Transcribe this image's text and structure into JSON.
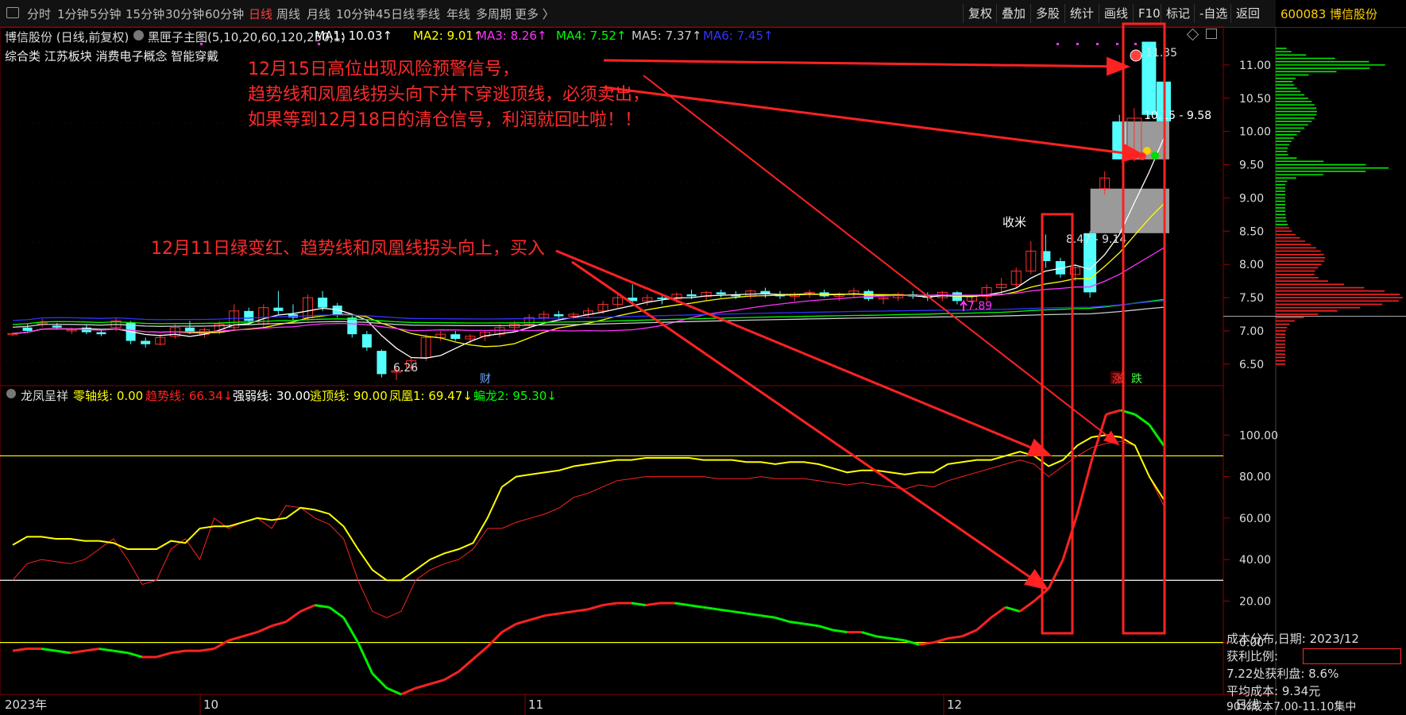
{
  "toolbar": {
    "periods": [
      "分时",
      "1分钟",
      "5分钟",
      "15分钟",
      "30分钟",
      "60分钟",
      "日线",
      "周线",
      "月线",
      "10分钟",
      "45日线",
      "季线",
      "年线",
      "多周期",
      "更多 〉"
    ],
    "active_period": "日线",
    "right_buttons": [
      "复权",
      "叠加",
      "多股",
      "统计",
      "画线",
      "F10",
      "标记",
      "-自选",
      "返回"
    ]
  },
  "stock": {
    "code_name": "600083 博信股份"
  },
  "main_panel": {
    "title": "博信股份 (日线,前复权)",
    "indicator_name": "黑匣子主图(5,10,20,60,120,250,1)",
    "ma_labels": [
      {
        "text": "MA1: 10.03",
        "color": "#ffffff"
      },
      {
        "text": "MA2: 9.01",
        "color": "#ffff00"
      },
      {
        "text": "MA3: 8.26",
        "color": "#ff33ff"
      },
      {
        "text": "MA4: 7.52",
        "color": "#00ff00"
      },
      {
        "text": "MA5: 7.37",
        "color": "#cccccc"
      },
      {
        "text": "MA6: 7.45",
        "color": "#3333ff"
      }
    ],
    "tags": "综合类  江苏板块  消费电子概念  智能穿戴"
  },
  "annotations": {
    "sell_note": [
      "12月15日高位出现风险预警信号，",
      "趋势线和凤凰线拐头向下并下穿逃顶线，必须卖出，",
      "如果等到12月18日的清仓信号，利润就回吐啦！！"
    ],
    "buy_note": "12月11日绿变红、趋势线和凤凰线拐头向上，买入",
    "label_shoumi": "收米",
    "label_high": "11.35",
    "label_range1": "10.15 - 9.58",
    "label_range2": "8.47 - 9.14",
    "label_low": "6.26",
    "label_789": "7.89",
    "label_cai": "财",
    "label_zhang": "涨",
    "label_die": "跌",
    "date_2023": "2023年",
    "date_10": "10",
    "date_11": "11",
    "date_12": "12",
    "bottom_right": "日线"
  },
  "sub_panel": {
    "name": "龙凤呈祥",
    "labels": [
      {
        "text": "零轴线: 0.00",
        "color": "#ffff00"
      },
      {
        "text": "趋势线: 66.34↓",
        "color": "#ff2222"
      },
      {
        "text": "强弱线: 30.00",
        "color": "#ffffff"
      },
      {
        "text": "逃顶线: 90.00",
        "color": "#ffff00"
      },
      {
        "text": "凤凰1: 69.47↓",
        "color": "#ffff00"
      },
      {
        "text": "蝙龙2: 95.30↓",
        "color": "#00ff00"
      }
    ]
  },
  "right_info": {
    "cost_title": "成本分布,日期: 2023/12",
    "profit_ratio_label": "获利比例:",
    "profit_line": "7.22处获利盘: 8.6%",
    "avg_cost": "平均成本: 9.34元",
    "cost_90": "90%成本7.00-11.10集中"
  },
  "chart_data": [
    {
      "type": "candlestick",
      "title": "博信股份 (日线,前复权)",
      "ylim": [
        6.2,
        11.5
      ],
      "yticks": [
        6.5,
        7.0,
        7.5,
        8.0,
        8.5,
        9.0,
        9.5,
        10.0,
        10.5,
        11.0
      ],
      "ohlc": [
        [
          6.95,
          6.98,
          6.92,
          6.96
        ],
        [
          7.05,
          7.1,
          6.98,
          7.0
        ],
        [
          7.1,
          7.18,
          7.05,
          7.12
        ],
        [
          7.08,
          7.12,
          7.02,
          7.05
        ],
        [
          7.0,
          7.05,
          6.95,
          7.02
        ],
        [
          7.05,
          7.1,
          6.95,
          6.98
        ],
        [
          6.98,
          7.02,
          6.92,
          6.95
        ],
        [
          7.05,
          7.2,
          7.0,
          7.15
        ],
        [
          7.12,
          7.15,
          6.8,
          6.85
        ],
        [
          6.85,
          6.9,
          6.75,
          6.8
        ],
        [
          6.8,
          6.95,
          6.78,
          6.9
        ],
        [
          6.92,
          7.1,
          6.88,
          7.05
        ],
        [
          7.05,
          7.15,
          6.95,
          6.98
        ],
        [
          6.95,
          7.05,
          6.9,
          7.02
        ],
        [
          6.98,
          7.15,
          6.95,
          7.1
        ],
        [
          7.05,
          7.4,
          7.0,
          7.3
        ],
        [
          7.3,
          7.35,
          7.1,
          7.15
        ],
        [
          7.1,
          7.4,
          7.05,
          7.35
        ],
        [
          7.35,
          7.6,
          7.25,
          7.3
        ],
        [
          7.25,
          7.4,
          7.15,
          7.2
        ],
        [
          7.2,
          7.55,
          7.15,
          7.5
        ],
        [
          7.5,
          7.6,
          7.3,
          7.35
        ],
        [
          7.38,
          7.42,
          7.2,
          7.25
        ],
        [
          7.2,
          7.25,
          6.9,
          6.95
        ],
        [
          6.95,
          7.0,
          6.7,
          6.75
        ],
        [
          6.7,
          6.72,
          6.3,
          6.35
        ],
        [
          6.38,
          6.45,
          6.26,
          6.4
        ],
        [
          6.45,
          6.6,
          6.4,
          6.55
        ],
        [
          6.6,
          6.95,
          6.55,
          6.9
        ],
        [
          6.9,
          7.0,
          6.85,
          6.95
        ],
        [
          6.95,
          7.0,
          6.85,
          6.88
        ],
        [
          6.88,
          6.95,
          6.8,
          6.92
        ],
        [
          6.92,
          7.0,
          6.85,
          6.98
        ],
        [
          6.95,
          7.1,
          6.9,
          7.05
        ],
        [
          7.05,
          7.15,
          7.0,
          7.1
        ],
        [
          7.1,
          7.25,
          7.05,
          7.2
        ],
        [
          7.2,
          7.3,
          7.15,
          7.25
        ],
        [
          7.25,
          7.3,
          7.18,
          7.22
        ],
        [
          7.22,
          7.28,
          7.18,
          7.25
        ],
        [
          7.25,
          7.35,
          7.2,
          7.3
        ],
        [
          7.3,
          7.45,
          7.25,
          7.4
        ],
        [
          7.4,
          7.55,
          7.35,
          7.5
        ],
        [
          7.5,
          7.7,
          7.4,
          7.45
        ],
        [
          7.45,
          7.55,
          7.38,
          7.5
        ],
        [
          7.5,
          7.55,
          7.4,
          7.48
        ],
        [
          7.48,
          7.58,
          7.42,
          7.55
        ],
        [
          7.55,
          7.62,
          7.48,
          7.52
        ],
        [
          7.52,
          7.6,
          7.45,
          7.58
        ],
        [
          7.58,
          7.62,
          7.5,
          7.55
        ],
        [
          7.55,
          7.6,
          7.48,
          7.52
        ],
        [
          7.52,
          7.62,
          7.48,
          7.6
        ],
        [
          7.6,
          7.65,
          7.5,
          7.55
        ],
        [
          7.55,
          7.6,
          7.48,
          7.52
        ],
        [
          7.52,
          7.58,
          7.45,
          7.55
        ],
        [
          7.55,
          7.62,
          7.5,
          7.58
        ],
        [
          7.58,
          7.62,
          7.5,
          7.52
        ],
        [
          7.52,
          7.58,
          7.45,
          7.55
        ],
        [
          7.55,
          7.65,
          7.5,
          7.6
        ],
        [
          7.6,
          7.62,
          7.45,
          7.48
        ],
        [
          7.48,
          7.55,
          7.4,
          7.5
        ],
        [
          7.5,
          7.58,
          7.45,
          7.55
        ],
        [
          7.55,
          7.6,
          7.48,
          7.52
        ],
        [
          7.52,
          7.58,
          7.45,
          7.5
        ],
        [
          7.5,
          7.6,
          7.45,
          7.58
        ],
        [
          7.58,
          7.6,
          7.4,
          7.45
        ],
        [
          7.45,
          7.55,
          7.4,
          7.52
        ],
        [
          7.52,
          7.7,
          7.45,
          7.65
        ],
        [
          7.65,
          7.8,
          7.55,
          7.7
        ],
        [
          7.7,
          7.95,
          7.65,
          7.9
        ],
        [
          7.9,
          8.35,
          7.85,
          8.2
        ],
        [
          8.2,
          8.45,
          7.95,
          8.05
        ],
        [
          8.05,
          8.1,
          7.8,
          7.85
        ],
        [
          7.85,
          8.0,
          7.75,
          7.95
        ],
        [
          8.47,
          8.5,
          7.5,
          7.58
        ],
        [
          9.14,
          9.4,
          9.05,
          9.3
        ],
        [
          10.15,
          10.25,
          9.58,
          9.58
        ],
        [
          9.58,
          10.35,
          9.55,
          10.2
        ],
        [
          11.35,
          11.35,
          10.2,
          10.25
        ],
        [
          10.75,
          10.9,
          10.15,
          10.15
        ]
      ]
    },
    {
      "type": "line",
      "title": "龙凤呈祥",
      "ylim": [
        -25,
        120
      ],
      "yticks": [
        0,
        20,
        40,
        60,
        80,
        100
      ],
      "hlines": [
        {
          "value": 0,
          "color": "#ffff00"
        },
        {
          "value": 30,
          "color": "#ffffff"
        },
        {
          "value": 90,
          "color": "#ffff00"
        }
      ],
      "series": [
        {
          "name": "凤凰1",
          "color": "#ffff00",
          "values": [
            47,
            51,
            51,
            50,
            50,
            49,
            49,
            48,
            45,
            45,
            45,
            49,
            48,
            55,
            56,
            56,
            58,
            60,
            59,
            60,
            65,
            64,
            62,
            56,
            45,
            35,
            30,
            30,
            35,
            40,
            43,
            45,
            48,
            60,
            75,
            80,
            81,
            82,
            83,
            85,
            86,
            87,
            88,
            88,
            89,
            89,
            89,
            89,
            88,
            88,
            88,
            87,
            87,
            86,
            87,
            87,
            86,
            84,
            82,
            83,
            83,
            82,
            81,
            82,
            82,
            86,
            87,
            88,
            88,
            90,
            92,
            90,
            85,
            88,
            95,
            99,
            100,
            99,
            95,
            80,
            69
          ]
        },
        {
          "name": "趋势线",
          "color": "#ff2222",
          "values": [
            30,
            38,
            40,
            39,
            38,
            40,
            45,
            50,
            40,
            28,
            30,
            45,
            50,
            40,
            60,
            55,
            58,
            60,
            55,
            66,
            65,
            60,
            57,
            50,
            30,
            15,
            12,
            15,
            30,
            35,
            38,
            40,
            45,
            55,
            55,
            58,
            60,
            62,
            65,
            70,
            72,
            75,
            78,
            79,
            80,
            80,
            80,
            80,
            80,
            79,
            79,
            79,
            80,
            79,
            79,
            79,
            78,
            77,
            76,
            77,
            76,
            75,
            74,
            76,
            75,
            78,
            80,
            82,
            84,
            86,
            88,
            86,
            80,
            85,
            90,
            94,
            96,
            97,
            95,
            80,
            66
          ]
        },
        {
          "name": "蝙龙2",
          "color": "#00ff00",
          "values": [
            -4,
            -3,
            -3,
            -4,
            -5,
            -4,
            -3,
            -4,
            -5,
            -7,
            -7,
            -5,
            -4,
            -4,
            -3,
            1,
            3,
            5,
            8,
            10,
            15,
            18,
            17,
            12,
            0,
            -15,
            -22,
            -25,
            -22,
            -20,
            -18,
            -14,
            -8,
            -2,
            5,
            9,
            11,
            13,
            14,
            15,
            16,
            18,
            19,
            19,
            18,
            19,
            19,
            18,
            17,
            16,
            15,
            14,
            13,
            12,
            10,
            9,
            8,
            6,
            5,
            5,
            3,
            2,
            1,
            -1,
            0,
            2,
            3,
            6,
            12,
            17,
            15,
            20,
            26,
            40,
            62,
            88,
            110,
            112,
            110,
            105,
            95
          ]
        }
      ]
    }
  ]
}
